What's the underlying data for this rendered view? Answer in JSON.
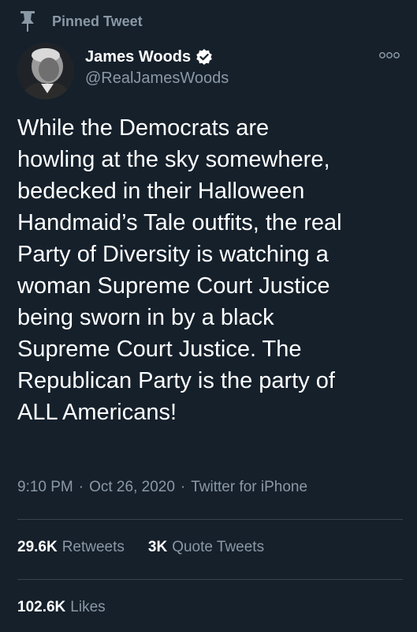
{
  "pinned": {
    "label": "Pinned Tweet",
    "icon": "pin-icon"
  },
  "author": {
    "display_name": "James Woods",
    "handle": "@RealJamesWoods",
    "verified_icon": "verified-badge-icon",
    "avatar_icon": "avatar"
  },
  "more_icon": "more-options-icon",
  "tweet": {
    "text": "While the Democrats are\nhowling at the sky somewhere,\nbedecked in their Halloween\nHandmaid’s Tale outfits, the real\nParty of Diversity is watching a\nwoman Supreme Court Justice\nbeing sworn in by a black\nSupreme Court Justice. The\nRepublican Party is the party of\nALL Americans!"
  },
  "meta": {
    "time": "9:10 PM",
    "separator": "·",
    "date": "Oct 26, 2020",
    "source": "Twitter for iPhone"
  },
  "stats": {
    "retweets_count": "29.6K",
    "retweets_label": "Retweets",
    "quotes_count": "3K",
    "quotes_label": "Quote Tweets",
    "likes_count": "102.6K",
    "likes_label": "Likes"
  },
  "colors": {
    "background": "#15202b",
    "text_primary": "#ffffff",
    "text_secondary": "#8b98a5",
    "divider": "#38444d"
  }
}
